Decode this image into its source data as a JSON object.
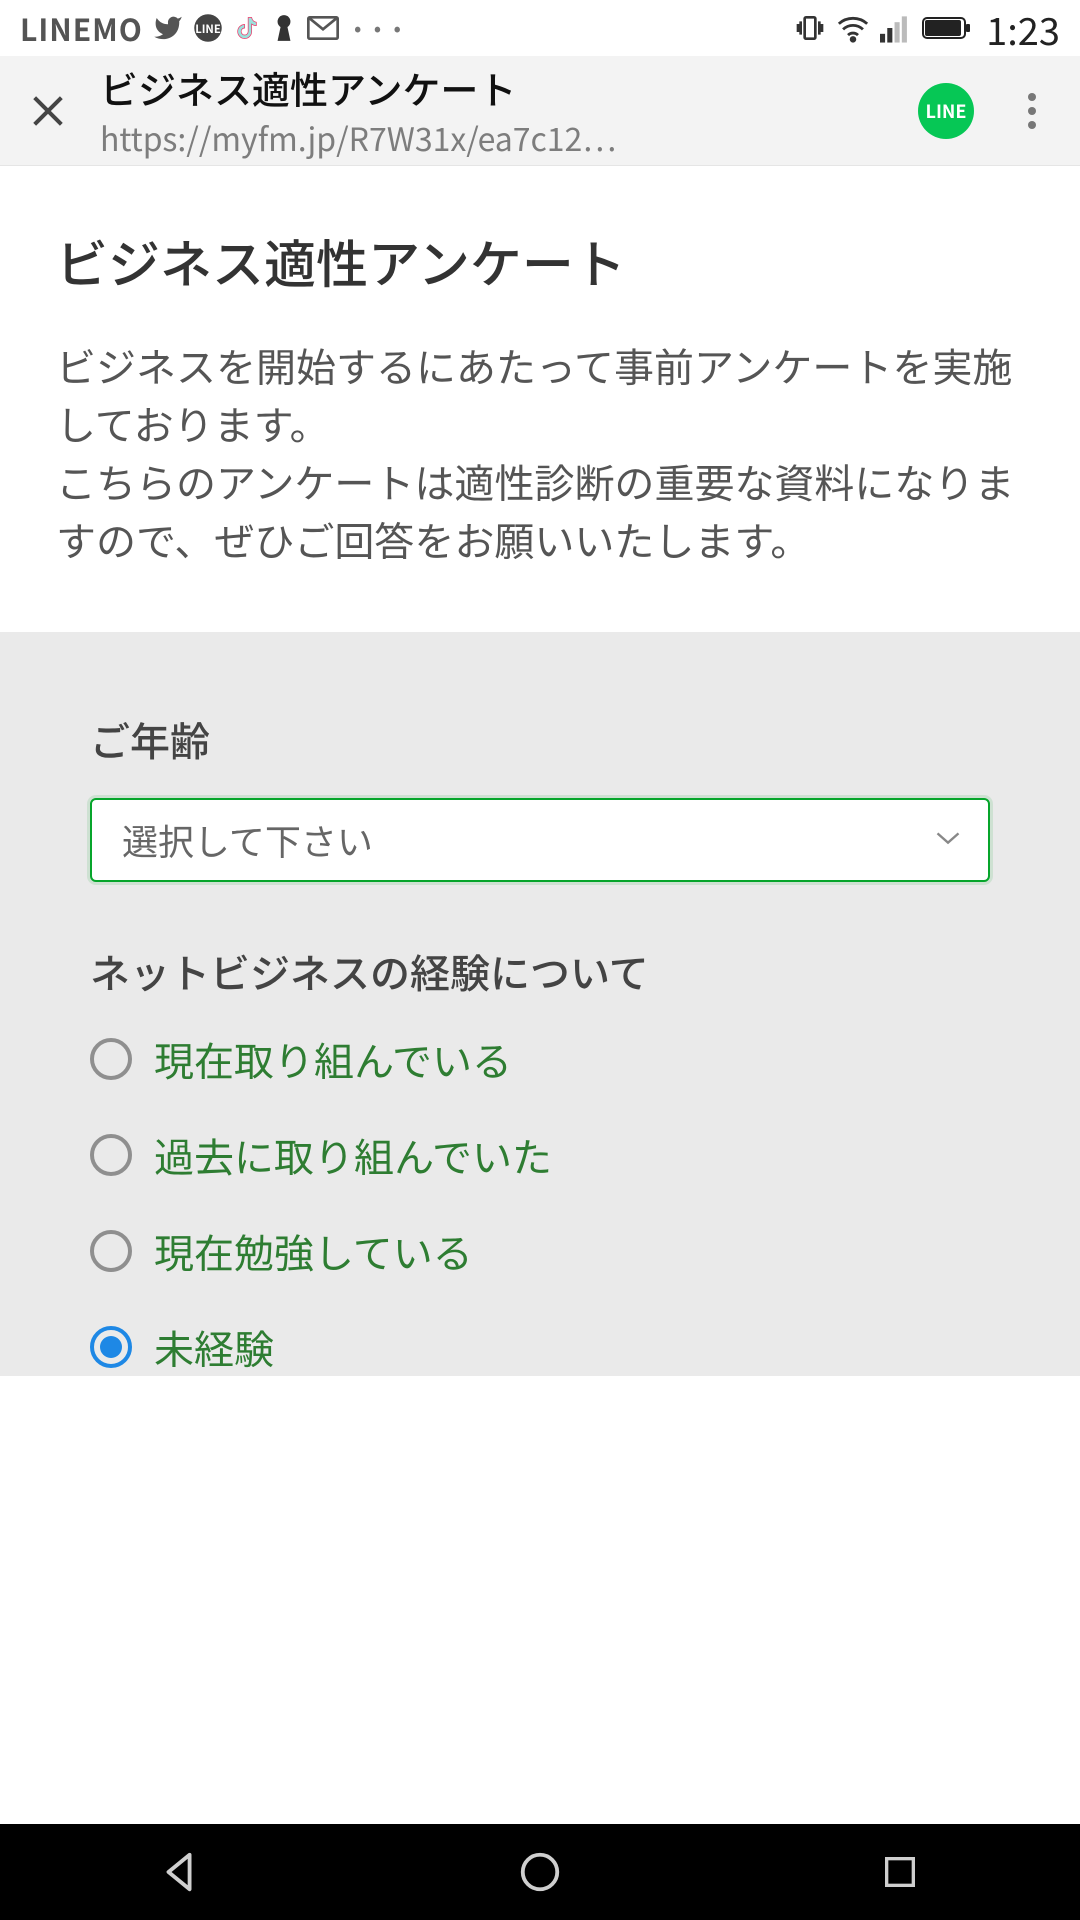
{
  "status": {
    "carrier": "LINEMO",
    "clock": "1:23"
  },
  "header": {
    "title": "ビジネス適性アンケート",
    "url": "https://myfm.jp/R7W31x/ea7c12…",
    "line_label": "LINE"
  },
  "intro": {
    "title": "ビジネス適性アンケート",
    "body_line1": "ビジネスを開始するにあたって事前アンケートを実施しております。",
    "body_line2": "こちらのアンケートは適性診断の重要な資料になりますので、ぜひご回答をお願いいたします。"
  },
  "form": {
    "q1_label": "ご年齢",
    "q1_placeholder": "選択して下さい",
    "q2_label": "ネットビジネスの経験について",
    "q2_options": [
      {
        "label": "現在取り組んでいる",
        "selected": false
      },
      {
        "label": "過去に取り組んでいた",
        "selected": false
      },
      {
        "label": "現在勉強している",
        "selected": false
      },
      {
        "label": "未経験",
        "selected": true
      }
    ]
  }
}
